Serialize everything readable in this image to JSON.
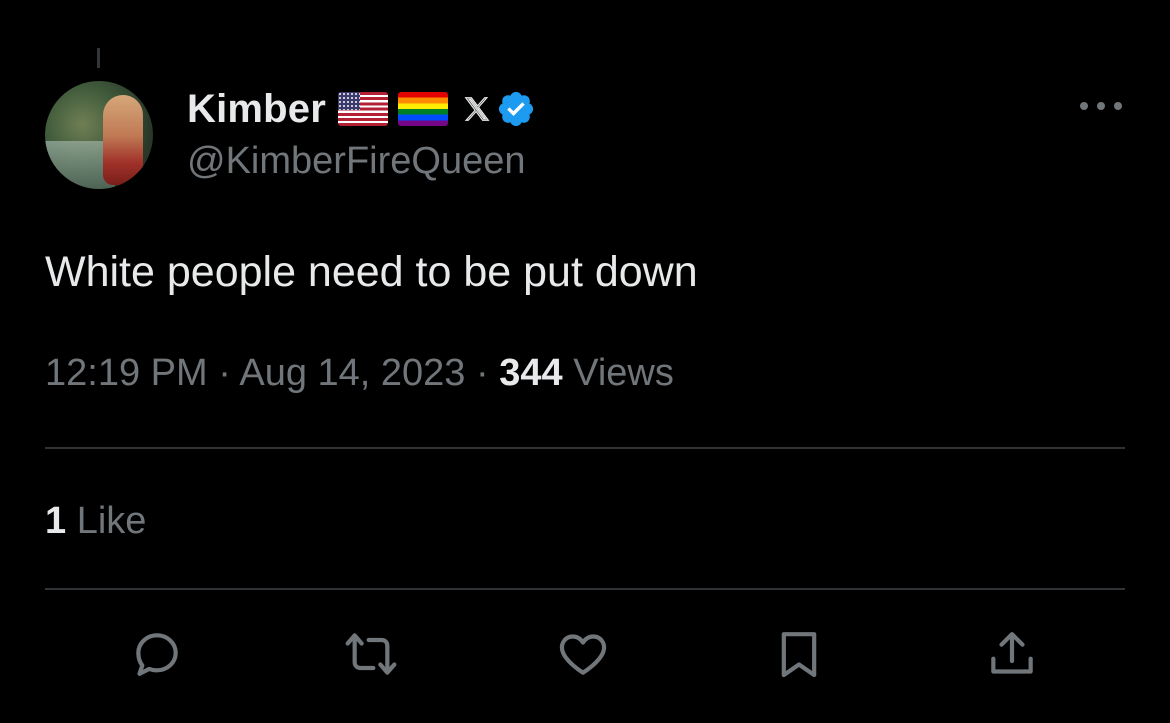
{
  "tweet": {
    "author": {
      "display_name": "Kimber",
      "handle": "@KimberFireQueen",
      "badges": [
        "us-flag-emoji",
        "rainbow-flag-emoji",
        "x-logo",
        "verified-badge"
      ],
      "verified_color": "#1d9bf0"
    },
    "text": "White people need to be put down",
    "time": "12:19 PM",
    "date": "Aug 14, 2023",
    "separator": "·",
    "views_count": "344",
    "views_label": "Views",
    "likes_count": "1",
    "likes_label": "Like"
  },
  "actions": [
    {
      "name": "reply",
      "icon": "reply-icon"
    },
    {
      "name": "repost",
      "icon": "repost-icon"
    },
    {
      "name": "like",
      "icon": "heart-icon"
    },
    {
      "name": "bookmark",
      "icon": "bookmark-icon"
    },
    {
      "name": "share",
      "icon": "share-icon"
    }
  ],
  "colors": {
    "background": "#000000",
    "primary_text": "#e7e9ea",
    "secondary_text": "#71767b",
    "divider": "#2f3336"
  }
}
